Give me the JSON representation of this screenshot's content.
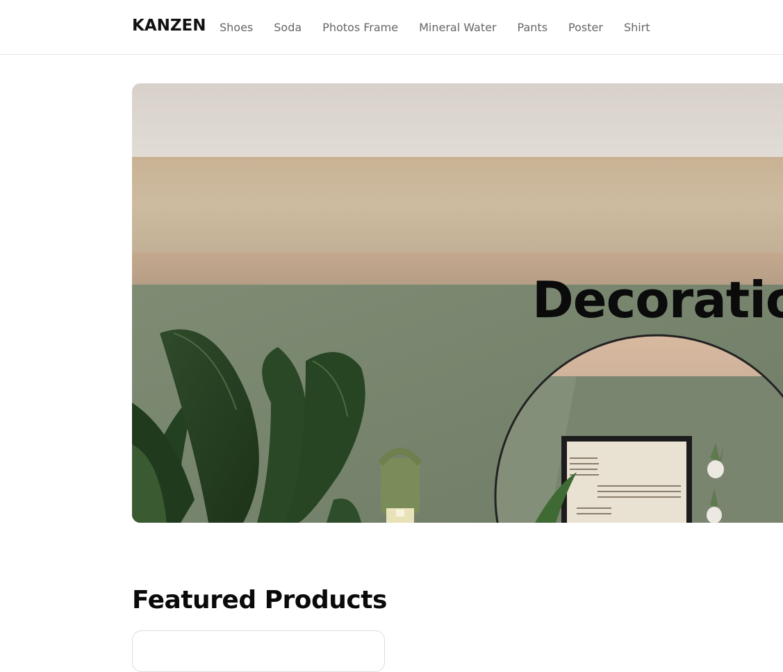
{
  "nav": {
    "brand": "KANZEN",
    "links": [
      {
        "label": "Shoes"
      },
      {
        "label": "Soda"
      },
      {
        "label": "Photos Frame"
      },
      {
        "label": "Mineral Water"
      },
      {
        "label": "Pants"
      },
      {
        "label": "Poster"
      },
      {
        "label": "Shirt"
      }
    ]
  },
  "hero": {
    "title": "Decoration",
    "image": "living-room-plants-mirror"
  },
  "featured": {
    "title": "Featured Products"
  },
  "colors": {
    "wall_green": "#7d8a72",
    "ceiling": "#dcd4cc",
    "trim": "#c9b8a0",
    "text": "#0b0b0b",
    "nav_link": "#666666"
  }
}
